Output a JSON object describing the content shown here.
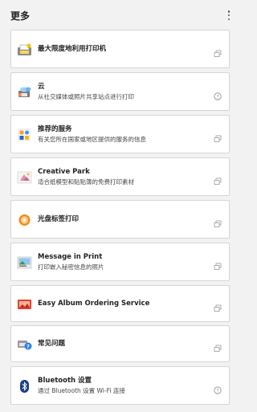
{
  "header": {
    "title": "更多"
  },
  "items": [
    {
      "title": "最大限度地利用打印机",
      "subtitle": "",
      "icon": "printer-tips-icon",
      "trailing": "external-link-icon"
    },
    {
      "title": "云",
      "subtitle": "从社交媒体或照片共享站点进行打印",
      "icon": "cloud-print-icon",
      "trailing": "help-icon"
    },
    {
      "title": "推荐的服务",
      "subtitle": "有关您所在国家或地区提供的服务的信息",
      "icon": "services-grid-icon",
      "trailing": "external-link-icon"
    },
    {
      "title": "Creative Park",
      "subtitle": "适合纸模型和贴贴簿的免费打印素材",
      "icon": "creative-park-icon",
      "trailing": "external-link-icon"
    },
    {
      "title": "光盘标签打印",
      "subtitle": "",
      "icon": "disc-label-icon",
      "trailing": "external-link-icon"
    },
    {
      "title": "Message in Print",
      "subtitle": "打印嵌入秘密信息的照片",
      "icon": "message-in-print-icon",
      "trailing": "external-link-icon"
    },
    {
      "title": "Easy Album Ordering Service",
      "subtitle": "",
      "icon": "album-icon",
      "trailing": "external-link-icon"
    },
    {
      "title": "常见问题",
      "subtitle": "",
      "icon": "faq-icon",
      "trailing": "external-link-icon"
    },
    {
      "title": "Bluetooth 设置",
      "subtitle": "通过 Bluetooth 设置 Wi-Fi 连接",
      "icon": "bluetooth-icon",
      "trailing": "help-icon"
    }
  ]
}
